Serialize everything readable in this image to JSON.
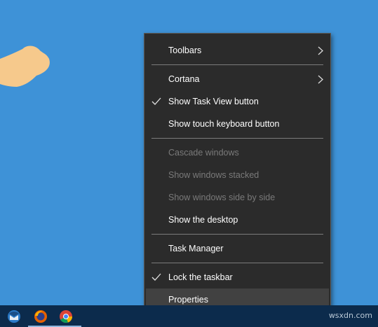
{
  "menu": {
    "items": [
      {
        "label": "Toolbars",
        "submenu": true
      },
      {
        "label": "Cortana",
        "submenu": true
      },
      {
        "label": "Show Task View button",
        "checked": true
      },
      {
        "label": "Show touch keyboard button"
      },
      {
        "label": "Cascade windows",
        "disabled": true
      },
      {
        "label": "Show windows stacked",
        "disabled": true
      },
      {
        "label": "Show windows side by side",
        "disabled": true
      },
      {
        "label": "Show the desktop"
      },
      {
        "label": "Task Manager"
      },
      {
        "label": "Lock the taskbar",
        "checked": true
      },
      {
        "label": "Properties",
        "highlighted": true
      }
    ]
  },
  "taskbar": {
    "icons": [
      "thunderbird-icon",
      "firefox-icon",
      "chrome-icon"
    ]
  },
  "watermark": "wsxdn.com",
  "colors": {
    "desktop": "#3e92d7",
    "menu_bg": "#2b2b2b",
    "menu_hover": "#414141",
    "taskbar": "#0c2b4c"
  }
}
